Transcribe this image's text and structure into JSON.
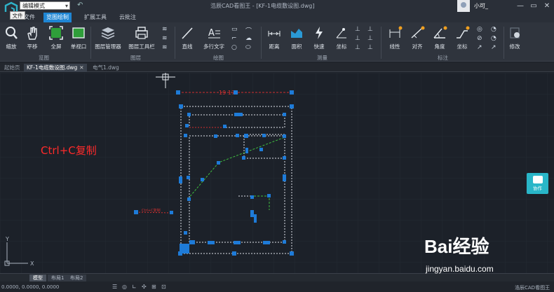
{
  "titlebar": {
    "mode": "编辑模式",
    "app_title": "浩辰CAD看图王 - [KF-1电缆敷设图.dwg]",
    "username": "小可_",
    "minimize": "—",
    "restore": "▭",
    "close": "✕"
  },
  "menu": {
    "file_tip": "文件",
    "tabs": [
      "文件",
      "览图绘制",
      "扩展工具",
      "云批注"
    ]
  },
  "ribbon": {
    "tools": {
      "zoom": "缩放",
      "pan": "平移",
      "fullscreen": "全屏",
      "single_view": "单视口",
      "layer_manager": "图层管理器",
      "layer_toolbar": "图层工具栏",
      "line": "直线",
      "mtext": "多行文字",
      "distance": "距离",
      "area": "面积",
      "quick": "快速",
      "coordinate": "坐标",
      "linear": "线性",
      "aligned": "对齐",
      "angle": "角度",
      "dim_coordinate": "坐标",
      "modify": "修改"
    },
    "groups": {
      "browse": "览图",
      "layer": "图层",
      "draw": "绘图",
      "measure": "测量",
      "annotate": "标注"
    }
  },
  "doc_tabs": [
    "起始页",
    "KF-1电缆敷设图.dwg",
    "电气1.dwg"
  ],
  "canvas": {
    "overlay_text": "Ctrl+C复制",
    "collab_label": "协作",
    "dim_label": "19 175",
    "red_note": "Ctrl+C复制"
  },
  "model_tabs": [
    "模型",
    "布局1",
    "布局2"
  ],
  "status": {
    "coords": "0.0000, 0.0000, 0.0000",
    "app": "浩辰CAD看图王"
  },
  "watermark": {
    "brand": "Bai经验",
    "url": "jingyan.baidu.com"
  },
  "colors": {
    "accent": "#1f86d4",
    "grip": "#1e7bd8",
    "overlay_red": "#ff2a2a",
    "collab": "#29b6c8",
    "green_dash": "#3fbf3f"
  }
}
